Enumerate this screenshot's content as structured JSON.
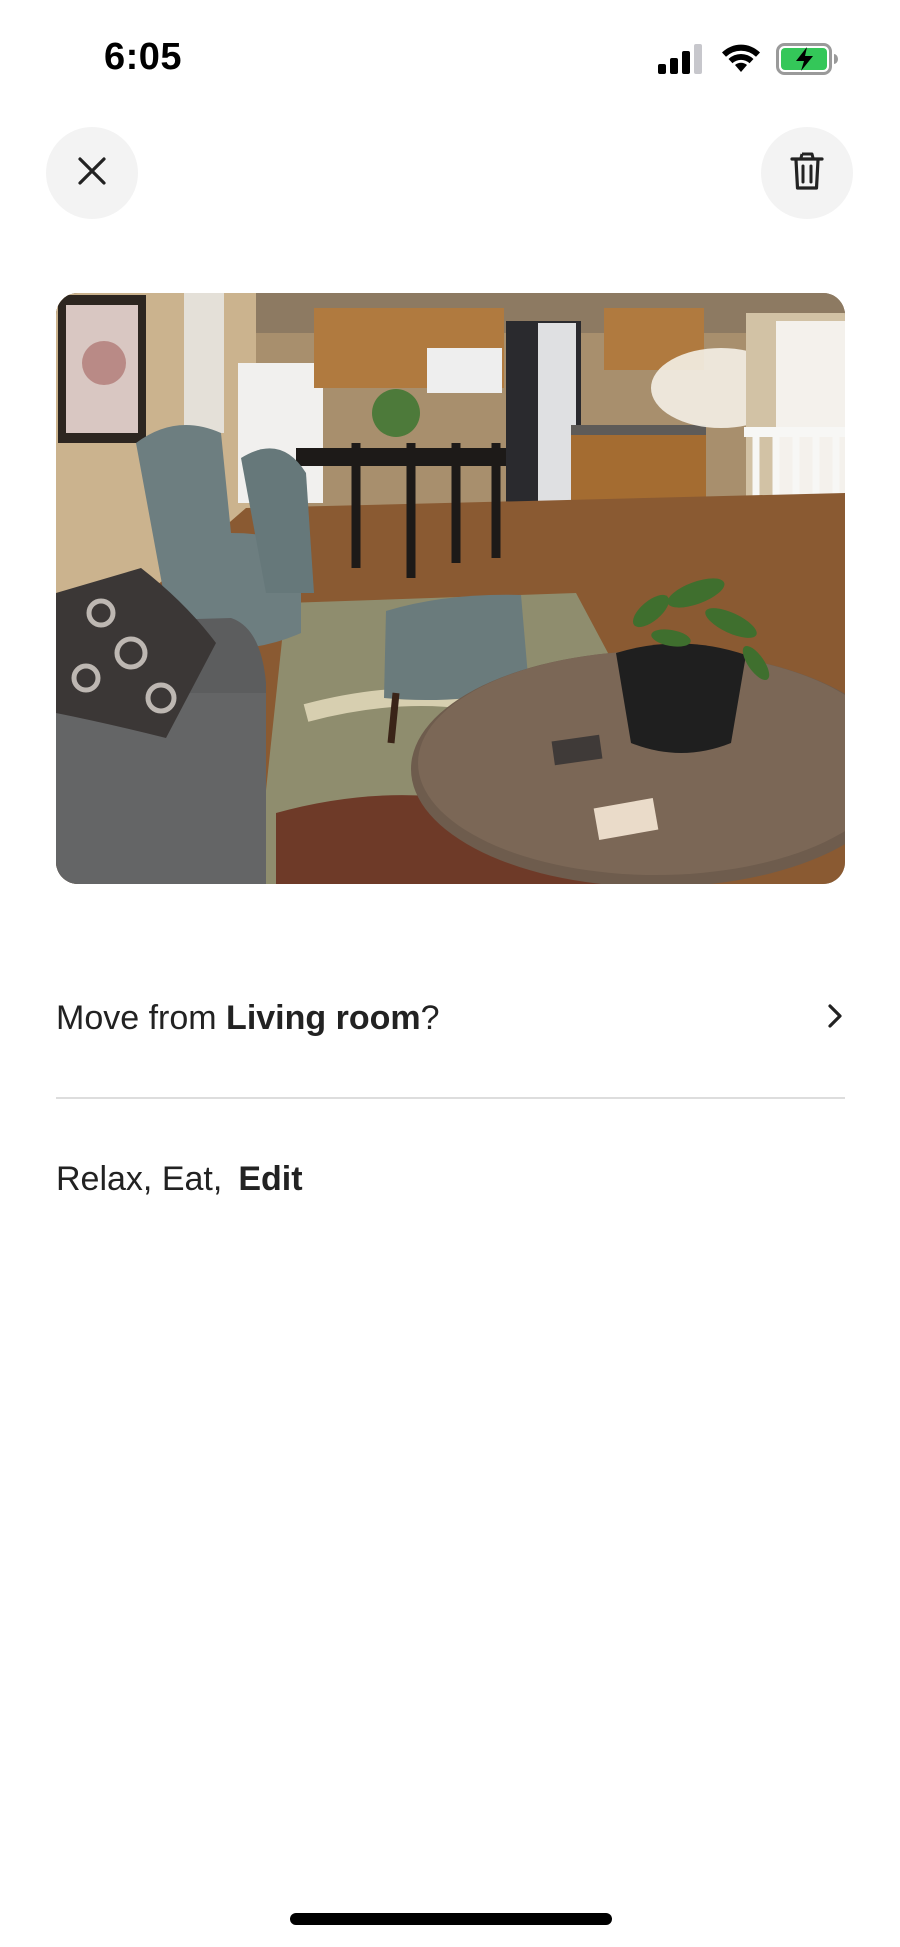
{
  "status": {
    "time": "6:05",
    "icons": [
      "signal-icon",
      "wifi-icon",
      "battery-charging-icon"
    ],
    "battery_color": "#34c759"
  },
  "toolbar": {
    "close_icon": "close-icon",
    "delete_icon": "trash-icon"
  },
  "photo": {
    "subject": "living-room-photo"
  },
  "move": {
    "prefix": "Move from ",
    "room": "Living room",
    "suffix": "?",
    "icon": "chevron-right-icon"
  },
  "tags": {
    "text": "Relax, Eat,",
    "edit_label": "Edit"
  },
  "colors": {
    "button_bg": "#f3f3f3",
    "text": "#222222",
    "divider": "#dddddd"
  }
}
